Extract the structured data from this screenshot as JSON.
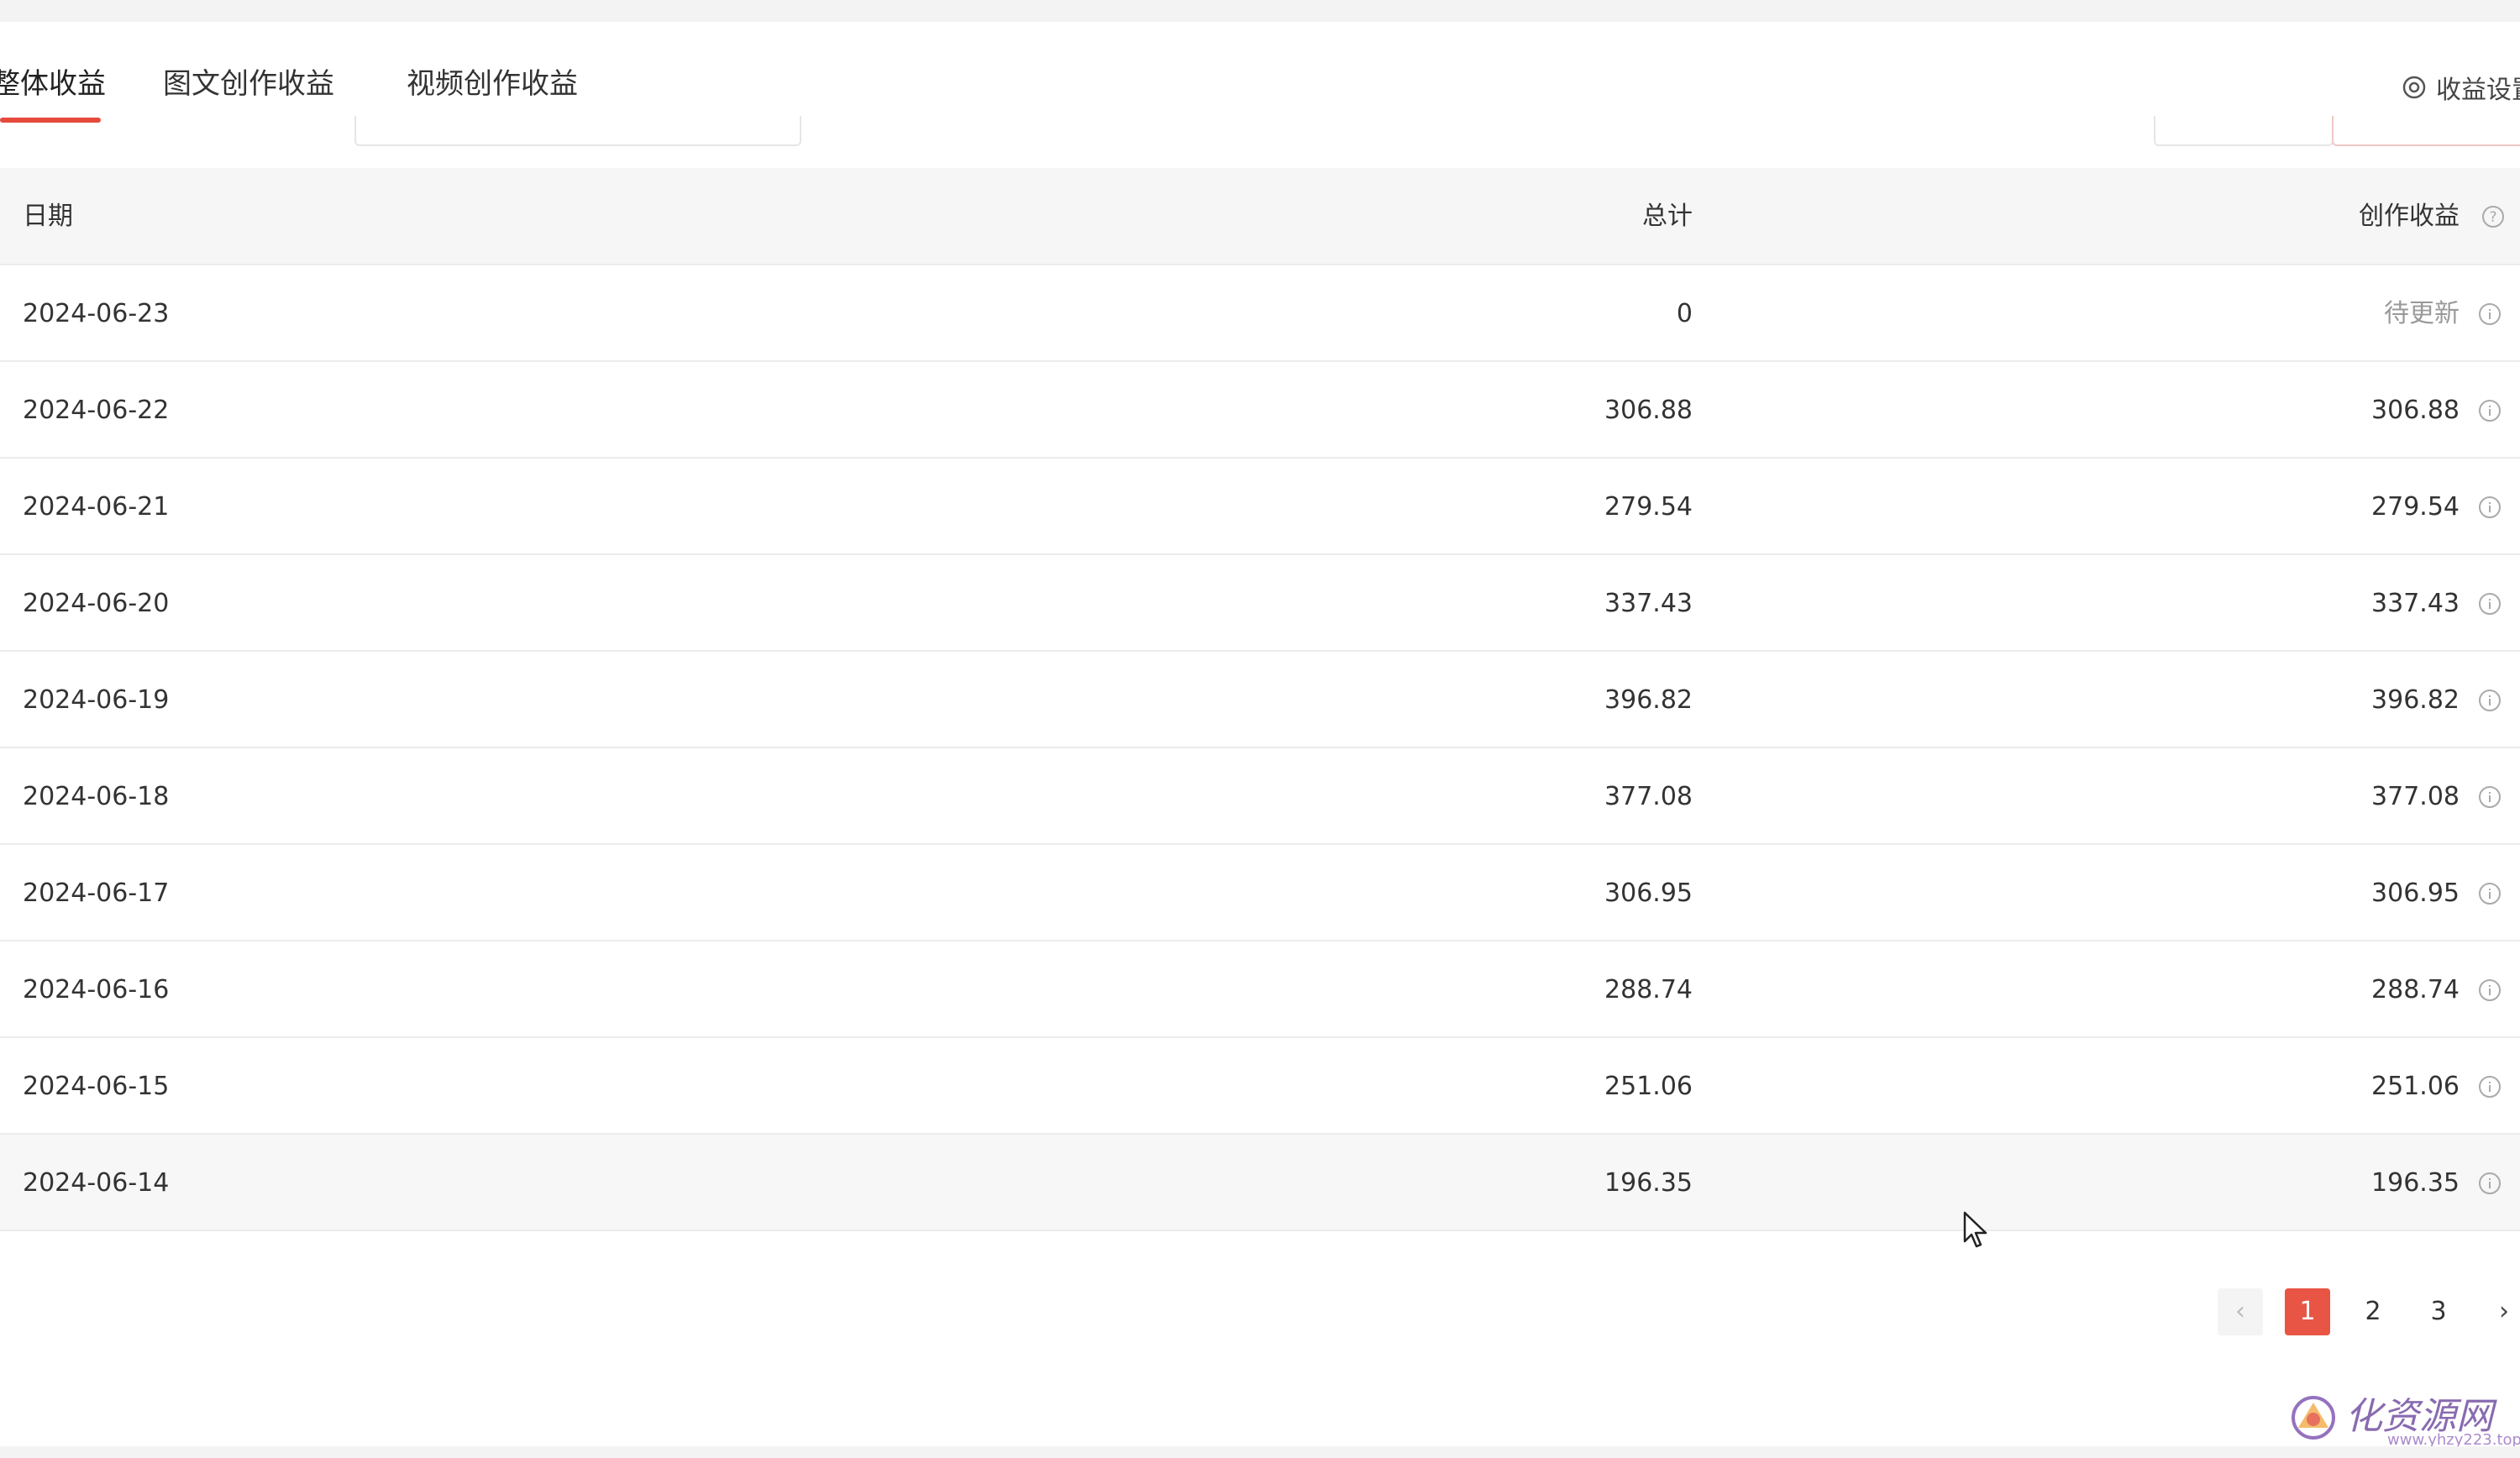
{
  "tabs": [
    {
      "label": "整体收益",
      "active": true
    },
    {
      "label": "图文创作收益",
      "active": false
    },
    {
      "label": "视频创作收益",
      "active": false
    }
  ],
  "settings": {
    "label": "收益设置"
  },
  "table": {
    "headers": {
      "date": "日期",
      "total": "总计",
      "earnings": "创作收益"
    },
    "rows": [
      {
        "date": "2024-06-23",
        "total": "0",
        "earnings": "待更新"
      },
      {
        "date": "2024-06-22",
        "total": "306.88",
        "earnings": "306.88"
      },
      {
        "date": "2024-06-21",
        "total": "279.54",
        "earnings": "279.54"
      },
      {
        "date": "2024-06-20",
        "total": "337.43",
        "earnings": "337.43"
      },
      {
        "date": "2024-06-19",
        "total": "396.82",
        "earnings": "396.82"
      },
      {
        "date": "2024-06-18",
        "total": "377.08",
        "earnings": "377.08"
      },
      {
        "date": "2024-06-17",
        "total": "306.95",
        "earnings": "306.95"
      },
      {
        "date": "2024-06-16",
        "total": "288.74",
        "earnings": "288.74"
      },
      {
        "date": "2024-06-15",
        "total": "251.06",
        "earnings": "251.06"
      },
      {
        "date": "2024-06-14",
        "total": "196.35",
        "earnings": "196.35"
      }
    ]
  },
  "pagination": {
    "prev": "‹",
    "next": "›",
    "pages": [
      "1",
      "2",
      "3"
    ],
    "current": "1"
  },
  "watermark": {
    "text": "化资源网",
    "url": "www.yhzy223.top"
  },
  "colors": {
    "accent": "#e85545",
    "tab_underline": "#e64a3c"
  }
}
